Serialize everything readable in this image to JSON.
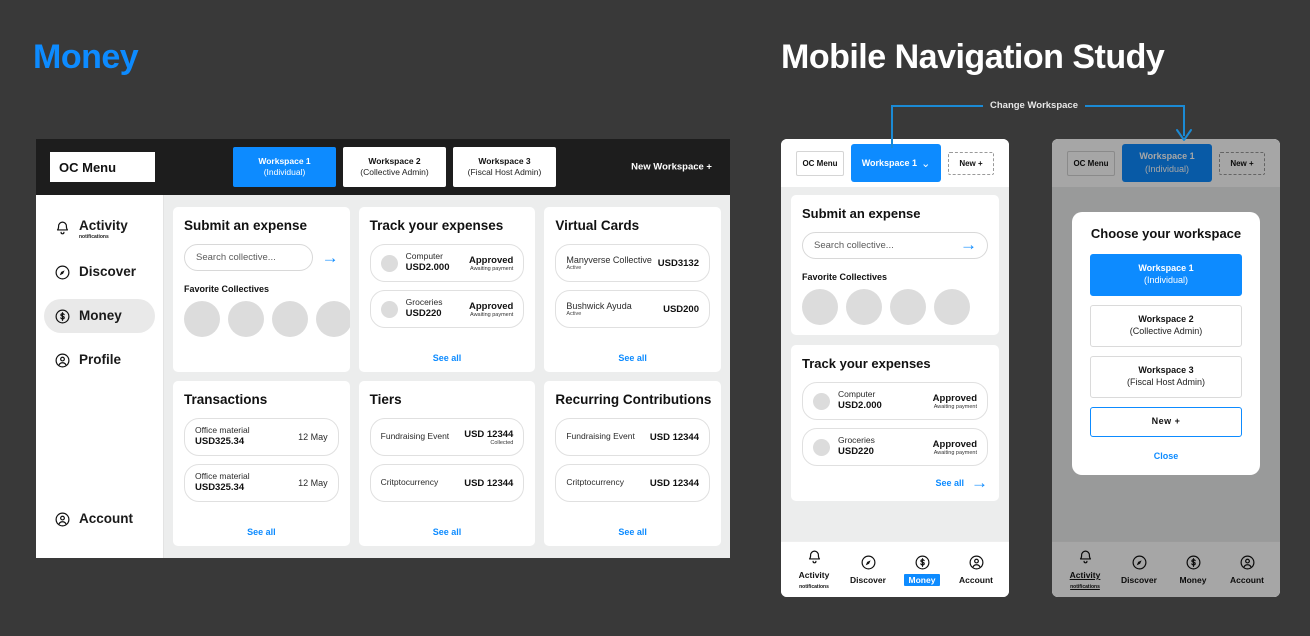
{
  "headings": {
    "left_title": "Money",
    "right_title": "Mobile Navigation Study",
    "accent_color": "#0d8bff",
    "background_color": "#393939"
  },
  "annotation": {
    "label": "Change Workspace",
    "color": "#1b8ad4"
  },
  "desktop": {
    "topbar": {
      "oc_menu": "OC Menu",
      "new_workspace": "New Workspace +",
      "workspaces": [
        {
          "name": "Workspace 1",
          "role": "(Individual)",
          "active": true
        },
        {
          "name": "Workspace 2",
          "role": "(Collective Admin)",
          "active": false
        },
        {
          "name": "Workspace 3",
          "role": "(Fiscal Host Admin)",
          "active": false
        }
      ]
    },
    "sidebar": {
      "items": [
        {
          "label": "Activity",
          "sub": "notifications",
          "icon": "bell-icon",
          "active": false
        },
        {
          "label": "Discover",
          "sub": "",
          "icon": "compass-icon",
          "active": false
        },
        {
          "label": "Money",
          "sub": "",
          "icon": "dollar-circle-icon",
          "active": true
        },
        {
          "label": "Profile",
          "sub": "",
          "icon": "person-circle-icon",
          "active": false
        }
      ],
      "account": {
        "label": "Account",
        "icon": "person-circle-icon"
      }
    },
    "cards": {
      "submit_expense": {
        "title": "Submit an expense",
        "search_placeholder": "Search collective...",
        "arrow_icon": "arrow-right-icon",
        "favorites_label": "Favorite Collectives",
        "avatar_count": 4
      },
      "track_expenses": {
        "title": "Track your expenses",
        "see_all": "See all",
        "rows": [
          {
            "name": "Computer",
            "amount": "USD2.000",
            "status": "Approved",
            "note": "Awaiting payment"
          },
          {
            "name": "Groceries",
            "amount": "USD220",
            "status": "Approved",
            "note": "Awaiting payment"
          }
        ]
      },
      "virtual_cards": {
        "title": "Virtual Cards",
        "see_all": "See all",
        "rows": [
          {
            "name": "Manyverse Collective",
            "state": "Active",
            "amount": "USD3132"
          },
          {
            "name": "Bushwick Ayuda",
            "state": "Active",
            "amount": "USD200"
          }
        ]
      },
      "transactions": {
        "title": "Transactions",
        "see_all": "See all",
        "rows": [
          {
            "name": "Office material",
            "amount": "USD325.34",
            "date": "12 May"
          },
          {
            "name": "Office material",
            "amount": "USD325.34",
            "date": "12 May"
          }
        ]
      },
      "tiers": {
        "title": "Tiers",
        "see_all": "See all",
        "rows": [
          {
            "name": "Fundraising Event",
            "amount": "USD 12344",
            "note": "Collected"
          },
          {
            "name": "Critptocurrency",
            "amount": "USD 12344",
            "note": ""
          }
        ]
      },
      "recurring": {
        "title": "Recurring Contributions",
        "see_all": "See all",
        "rows": [
          {
            "name": "Fundraising Event",
            "amount": "USD 12344",
            "note": ""
          },
          {
            "name": "Critptocurrency",
            "amount": "USD 12344",
            "note": ""
          }
        ]
      }
    }
  },
  "phone_a": {
    "top": {
      "oc_menu": "OC Menu",
      "workspace": "Workspace 1",
      "chevron_icon": "chevron-down-icon",
      "new": "New +"
    },
    "submit_expense": {
      "title": "Submit an expense",
      "search_placeholder": "Search collective...",
      "arrow_icon": "arrow-right-icon",
      "favorites_label": "Favorite Collectives",
      "avatar_count": 4
    },
    "track_expenses": {
      "title": "Track your expenses",
      "see_all": "See all",
      "arrow_icon": "arrow-right-icon",
      "rows": [
        {
          "name": "Computer",
          "amount": "USD2.000",
          "status": "Approved",
          "note": "Awaiting payment"
        },
        {
          "name": "Groceries",
          "amount": "USD220",
          "status": "Approved",
          "note": "Awaiting payment"
        }
      ]
    },
    "tabs": [
      {
        "label": "Activity",
        "sub": "notifications",
        "icon": "bell-icon",
        "selected": false,
        "underlined": false
      },
      {
        "label": "Discover",
        "sub": "",
        "icon": "compass-icon",
        "selected": false,
        "underlined": false
      },
      {
        "label": "Money",
        "sub": "",
        "icon": "dollar-circle-icon",
        "selected": true,
        "underlined": false
      },
      {
        "label": "Account",
        "sub": "",
        "icon": "person-circle-icon",
        "selected": false,
        "underlined": false
      }
    ]
  },
  "phone_b": {
    "top": {
      "oc_menu": "OC Menu",
      "workspace_name": "Workspace 1",
      "workspace_role": "(Individual)",
      "new": "New +"
    },
    "modal": {
      "title": "Choose your workspace",
      "options": [
        {
          "name": "Workspace 1",
          "role": "(Individual)",
          "selected": true
        },
        {
          "name": "Workspace 2",
          "role": "(Collective Admin)",
          "selected": false
        },
        {
          "name": "Workspace 3",
          "role": "(Fiscal Host Admin)",
          "selected": false
        }
      ],
      "new_button": "New  +",
      "close": "Close"
    },
    "tabs": [
      {
        "label": "Activity",
        "sub": "notifications",
        "icon": "bell-icon",
        "selected": false,
        "underlined": true
      },
      {
        "label": "Discover",
        "sub": "",
        "icon": "compass-icon",
        "selected": false,
        "underlined": false
      },
      {
        "label": "Money",
        "sub": "",
        "icon": "dollar-circle-icon",
        "selected": false,
        "underlined": false
      },
      {
        "label": "Account",
        "sub": "",
        "icon": "person-circle-icon",
        "selected": false,
        "underlined": false
      }
    ]
  }
}
